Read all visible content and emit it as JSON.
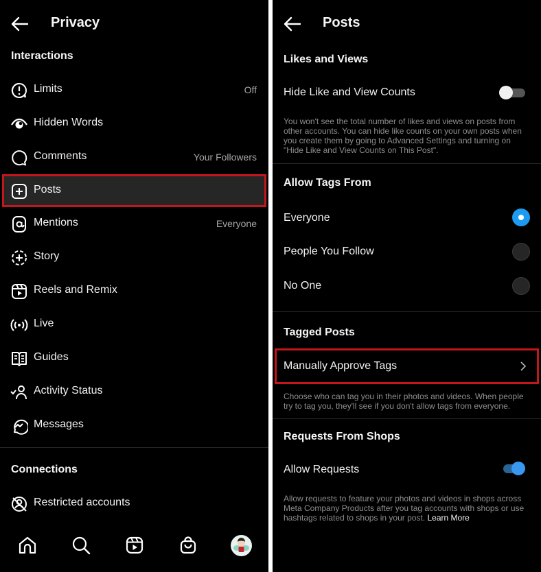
{
  "left": {
    "header": {
      "title": "Privacy",
      "back_icon": "arrow-left-icon"
    },
    "sections": {
      "interactions": "Interactions",
      "connections": "Connections"
    },
    "items": [
      {
        "label": "Limits",
        "value": "Off",
        "icon": "limits-icon"
      },
      {
        "label": "Hidden Words",
        "value": "",
        "icon": "hidden-words-icon"
      },
      {
        "label": "Comments",
        "value": "Your Followers",
        "icon": "comment-icon"
      },
      {
        "label": "Posts",
        "value": "",
        "icon": "add-post-icon",
        "highlighted": true
      },
      {
        "label": "Mentions",
        "value": "Everyone",
        "icon": "mention-icon"
      },
      {
        "label": "Story",
        "value": "",
        "icon": "story-icon"
      },
      {
        "label": "Reels and Remix",
        "value": "",
        "icon": "reels-icon"
      },
      {
        "label": "Live",
        "value": "",
        "icon": "live-icon"
      },
      {
        "label": "Guides",
        "value": "",
        "icon": "guides-icon"
      },
      {
        "label": "Activity Status",
        "value": "",
        "icon": "activity-status-icon"
      },
      {
        "label": "Messages",
        "value": "",
        "icon": "messenger-icon"
      }
    ],
    "connection_items": [
      {
        "label": "Restricted accounts",
        "icon": "restricted-icon"
      }
    ],
    "bottom_nav": [
      "home-icon",
      "search-icon",
      "reels-icon",
      "shop-icon",
      "profile-avatar"
    ]
  },
  "right": {
    "header": {
      "title": "Posts",
      "back_icon": "arrow-left-icon"
    },
    "likes_views": {
      "title": "Likes and Views",
      "toggle_label": "Hide Like and View Counts",
      "toggle_on": false,
      "description": "You won't see the total number of likes and views on posts from other accounts. You can hide like counts on your own posts when you create them by going to Advanced Settings and turning on \"Hide Like and View Counts on This Post\"."
    },
    "allow_tags": {
      "title": "Allow Tags From",
      "options": [
        {
          "label": "Everyone",
          "selected": true
        },
        {
          "label": "People You Follow",
          "selected": false
        },
        {
          "label": "No One",
          "selected": false
        }
      ]
    },
    "tagged_posts": {
      "title": "Tagged Posts",
      "row_label": "Manually Approve Tags",
      "description": "Choose who can tag you in their photos and videos. When people try to tag you, they'll see if you don't allow tags from everyone."
    },
    "shops": {
      "title": "Requests From Shops",
      "toggle_label": "Allow Requests",
      "toggle_on": true,
      "description": "Allow requests to feature your photos and videos in shops across Meta Company Products after you tag accounts with shops or use hashtags related to shops in your post.",
      "link": "Learn More"
    }
  },
  "colors": {
    "background": "#000000",
    "highlight_border": "#c4161c",
    "accent_blue": "#1d9bf0",
    "secondary_text": "#a8a8a8"
  }
}
